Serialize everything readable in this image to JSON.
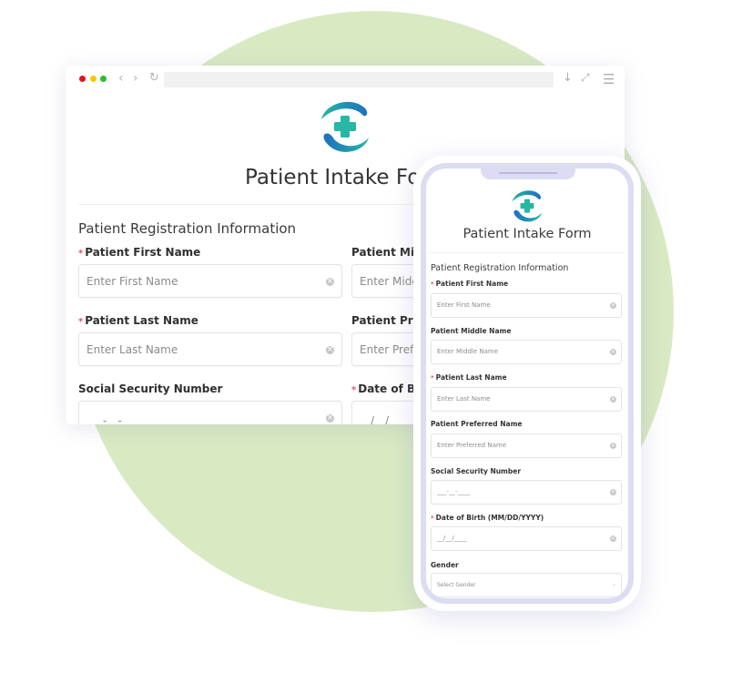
{
  "colors": {
    "background_circle": "#d9eac3",
    "required_asterisk": "#e8506a",
    "logo_teal": "#26b7a5",
    "logo_blue": "#1e7fc4",
    "phone_frame": "#dcdcf2"
  },
  "browser": {
    "traffic_lights": [
      "close",
      "minimize",
      "maximize"
    ],
    "icons": {
      "back": "‹",
      "forward": "›",
      "reload": "↻",
      "download": "↓",
      "expand": "⤢",
      "menu": "☰"
    }
  },
  "desktop_form": {
    "title": "Patient Intake Form",
    "section": "Patient Registration Information",
    "fields": [
      {
        "label": "Patient First Name",
        "required": true,
        "placeholder": "Enter First Name"
      },
      {
        "label": "Patient Middle Name",
        "required": false,
        "placeholder": "Enter Middle Name"
      },
      {
        "label": "Patient Last Name",
        "required": true,
        "placeholder": "Enter Last Name"
      },
      {
        "label": "Patient Preferred Name",
        "required": false,
        "placeholder": "Enter Preferred Name"
      },
      {
        "label": "Social Security Number",
        "required": false,
        "placeholder": "___-__-____"
      },
      {
        "label": "Date of Birth (MM/DD/YYYY)",
        "required": true,
        "placeholder": "__/__/____"
      }
    ]
  },
  "mobile_form": {
    "title": "Patient Intake Form",
    "section": "Patient Registration Information",
    "fields": [
      {
        "label": "Patient First Name",
        "required": true,
        "placeholder": "Enter First Name"
      },
      {
        "label": "Patient Middle Name",
        "required": false,
        "placeholder": "Enter Middle Name"
      },
      {
        "label": "Patient Last Name",
        "required": true,
        "placeholder": "Enter Last Name"
      },
      {
        "label": "Patient Preferred Name",
        "required": false,
        "placeholder": "Enter Preferred Name"
      },
      {
        "label": "Social Security Number",
        "required": false,
        "placeholder": "___-__-____"
      },
      {
        "label": "Date of Birth (MM/DD/YYYY)",
        "required": true,
        "placeholder": "__/__/____"
      },
      {
        "label": "Gender",
        "required": false,
        "placeholder": "Select Gender",
        "type": "select"
      }
    ]
  },
  "req_mark": "*"
}
